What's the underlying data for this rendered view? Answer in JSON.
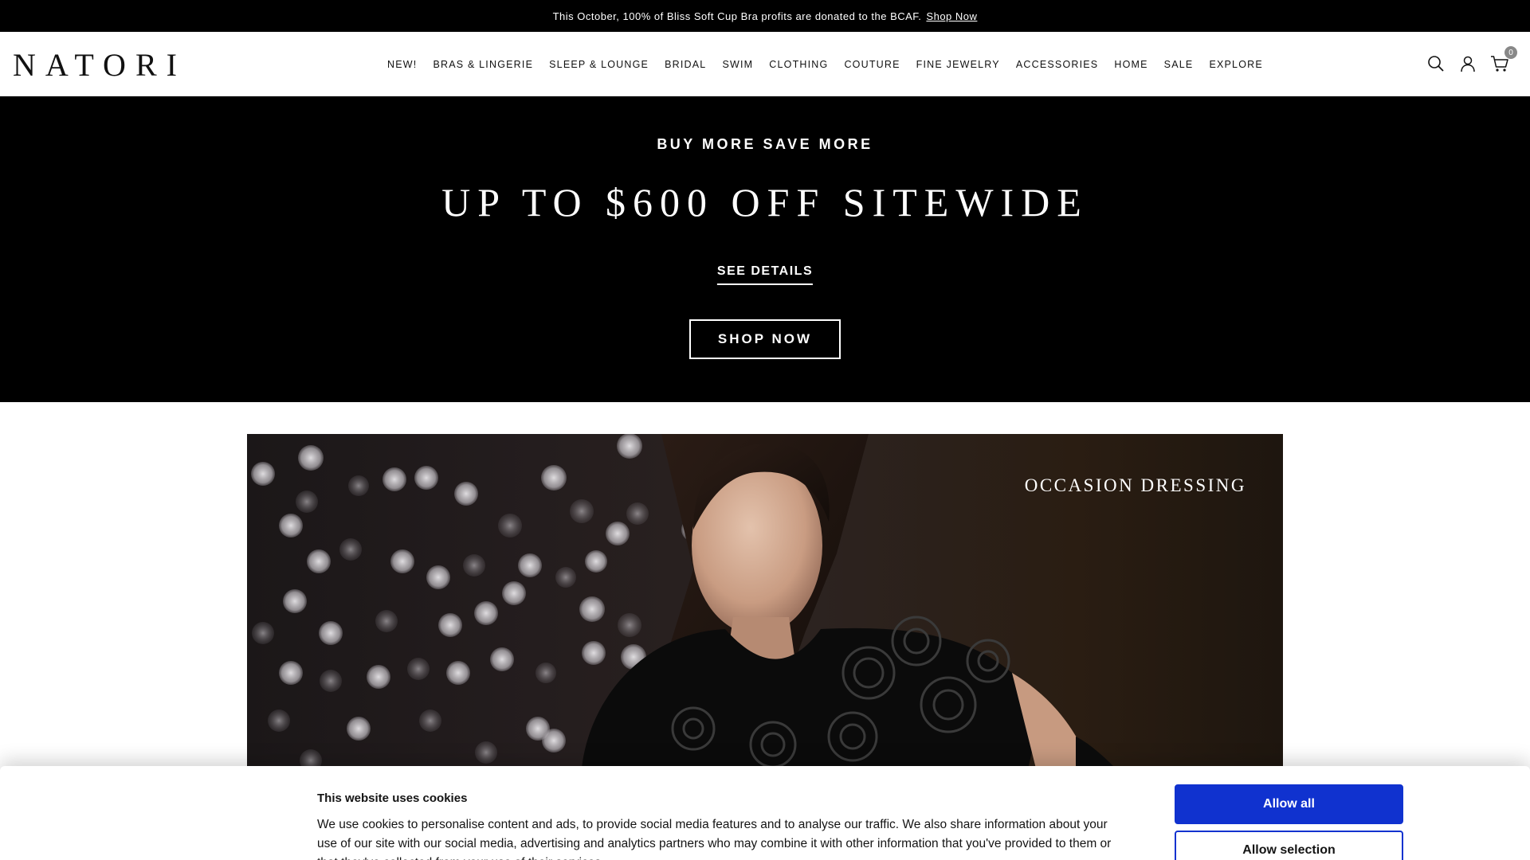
{
  "announcement": {
    "text": "This October, 100% of Bliss Soft Cup Bra profits are donated to the BCAF.",
    "link": "Shop Now"
  },
  "header": {
    "logo": "NATORI",
    "nav": [
      {
        "label": "NEW!"
      },
      {
        "label": "BRAS & LINGERIE"
      },
      {
        "label": "SLEEP & LOUNGE"
      },
      {
        "label": "BRIDAL"
      },
      {
        "label": "SWIM"
      },
      {
        "label": "CLOTHING"
      },
      {
        "label": "COUTURE"
      },
      {
        "label": "FINE JEWELRY"
      },
      {
        "label": "ACCESSORIES"
      },
      {
        "label": "HOME"
      },
      {
        "label": "SALE"
      },
      {
        "label": "EXPLORE"
      }
    ],
    "icons": {
      "search": "search-icon",
      "account": "user-icon",
      "cart": "cart-icon"
    },
    "cart_count": "0"
  },
  "promo": {
    "eyebrow": "BUY MORE SAVE MORE",
    "title": "UP TO $600 OFF SITEWIDE",
    "details_link": "SEE DETAILS",
    "cta": "SHOP NOW"
  },
  "occasion_banner": {
    "label": "OCCASION DRESSING"
  },
  "cookie_banner": {
    "title": "This website uses cookies",
    "text": "We use cookies to personalise content and ads, to provide social media features and to analyse our traffic. We also share information about your use of our site with our social media, advertising and analytics partners who may combine it with other information that you've provided to them or that they've collected from your use of their services.",
    "allow_all": "Allow all",
    "allow_selection": "Allow selection"
  },
  "colors": {
    "announcement_bg": "#000000",
    "promo_bg": "#000000",
    "cookie_primary": "#1032cf"
  }
}
